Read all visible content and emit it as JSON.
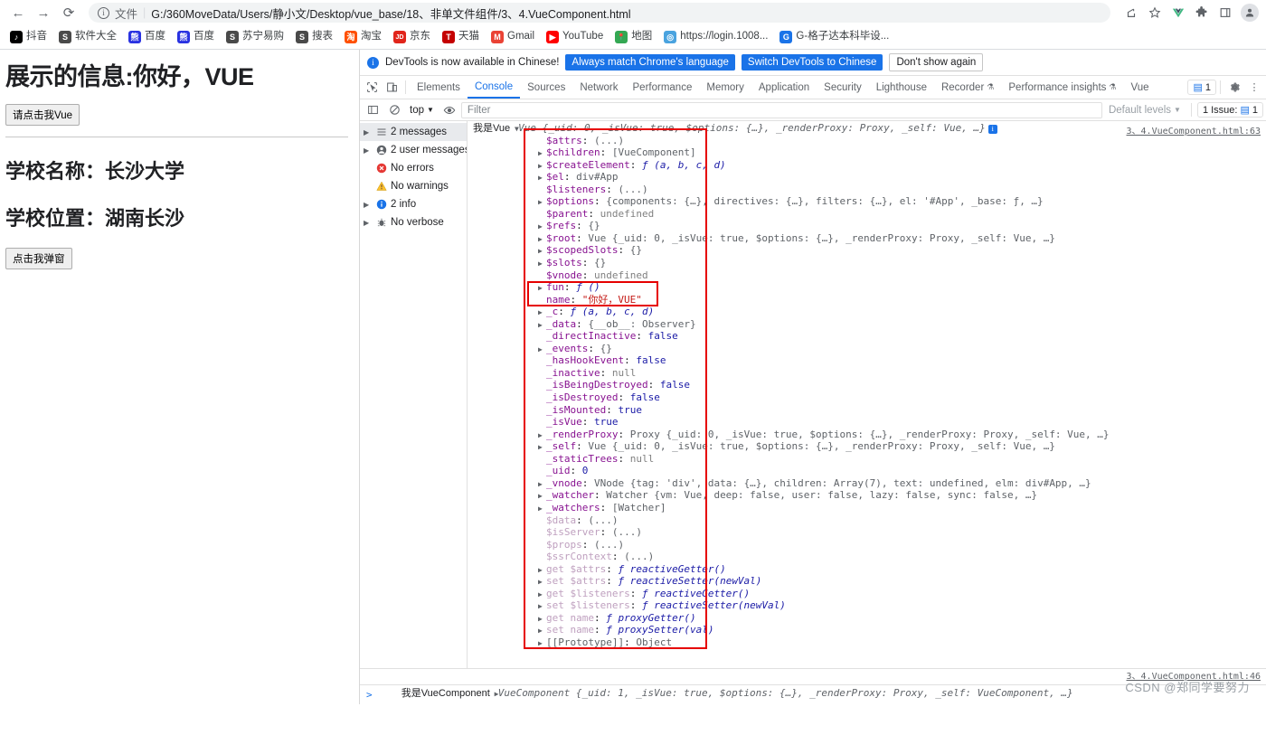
{
  "browser": {
    "nav": {
      "back_icon": "arrow-left-icon",
      "forward_icon": "arrow-right-icon",
      "reload_icon": "reload-icon"
    },
    "omnibox": {
      "info_icon": "info-circle-icon",
      "scheme_label": "文件",
      "url": "G:/360MoveData/Users/静小文/Desktop/vue_base/18、非单文件组件/3、4.VueComponent.html"
    },
    "toolbar_icons": [
      {
        "name": "share-icon",
        "glyph": "⇪"
      },
      {
        "name": "bookmark-star-icon",
        "glyph": "☆"
      },
      {
        "name": "vue-devtools-extension-icon",
        "glyph": "V"
      },
      {
        "name": "extensions-puzzle-icon",
        "glyph": "🧩"
      },
      {
        "name": "sidepanel-icon",
        "glyph": "▯"
      },
      {
        "name": "profile-avatar-icon",
        "glyph": "●"
      }
    ],
    "bookmarks": [
      {
        "label": "抖音",
        "color": "#000000",
        "glyph": "♪"
      },
      {
        "label": "软件大全",
        "color": "#4a4a4a",
        "glyph": "S"
      },
      {
        "label": "百度",
        "color": "#2932e1",
        "glyph": "熊"
      },
      {
        "label": "百度",
        "color": "#2932e1",
        "glyph": "熊"
      },
      {
        "label": "苏宁易购",
        "color": "#4a4a4a",
        "glyph": "S"
      },
      {
        "label": "搜表",
        "color": "#4a4a4a",
        "glyph": "S"
      },
      {
        "label": "淘宝",
        "color": "#ff5000",
        "glyph": "淘"
      },
      {
        "label": "京东",
        "color": "#e1251b",
        "glyph": "JD"
      },
      {
        "label": "天猫",
        "color": "#c40000",
        "glyph": "T"
      },
      {
        "label": "Gmail",
        "color": "#ea4335",
        "glyph": "M"
      },
      {
        "label": "YouTube",
        "color": "#ff0000",
        "glyph": "▶"
      },
      {
        "label": "地图",
        "color": "#34a853",
        "glyph": "📍"
      },
      {
        "label": "https://login.1008...",
        "color": "#4aa3df",
        "glyph": "◎"
      },
      {
        "label": "G-格子达本科毕设...",
        "color": "#1a73e8",
        "glyph": "G"
      }
    ]
  },
  "page": {
    "heading": "展示的信息:你好，VUE",
    "button_vue": "请点击我Vue",
    "school_name_line": "学校名称：长沙大学",
    "school_location_line": "学校位置：湖南长沙",
    "button_alert": "点击我弹窗"
  },
  "devtools": {
    "banner": {
      "icon": "info-circle-icon",
      "text": "DevTools is now available in Chinese!",
      "btn_always": "Always match Chrome's language",
      "btn_switch": "Switch DevTools to Chinese",
      "btn_dismiss": "Don't show again"
    },
    "tabbar": {
      "inspect_icon": "inspect-element-icon",
      "device_icon": "device-toolbar-icon",
      "tabs": [
        {
          "label": "Elements",
          "active": false
        },
        {
          "label": "Console",
          "active": true
        },
        {
          "label": "Sources",
          "active": false
        },
        {
          "label": "Network",
          "active": false
        },
        {
          "label": "Performance",
          "active": false
        },
        {
          "label": "Memory",
          "active": false
        },
        {
          "label": "Application",
          "active": false
        },
        {
          "label": "Security",
          "active": false
        },
        {
          "label": "Lighthouse",
          "active": false
        },
        {
          "label": "Recorder",
          "active": false,
          "badge": "experiment-flask-icon"
        },
        {
          "label": "Performance insights",
          "active": false,
          "badge": "experiment-flask-icon"
        },
        {
          "label": "Vue",
          "active": false
        }
      ],
      "message_count": "1",
      "settings_icon": "gear-icon",
      "more_icon": "kebab-menu-icon"
    },
    "filterbar": {
      "sidebar_toggle_icon": "console-sidebar-icon",
      "clear_icon": "clear-console-icon",
      "context_label": "top",
      "eye_icon": "live-expression-eye-icon",
      "filter_placeholder": "Filter",
      "filter_value": "",
      "levels_label": "Default levels",
      "issues_label": "1 Issue:",
      "issues_count": "1"
    },
    "sidebar": [
      {
        "label": "2 messages",
        "icon": "list-icon",
        "arrow": true,
        "selected": true
      },
      {
        "label": "2 user messages",
        "icon": "user-icon",
        "arrow": true,
        "selected": false
      },
      {
        "label": "No errors",
        "icon": "error-icon",
        "arrow": false,
        "selected": false
      },
      {
        "label": "No warnings",
        "icon": "warning-icon",
        "arrow": false,
        "selected": false
      },
      {
        "label": "2 info",
        "icon": "info-icon",
        "arrow": true,
        "selected": false
      },
      {
        "label": "No verbose",
        "icon": "verbose-bug-icon",
        "arrow": true,
        "selected": false
      }
    ],
    "console": {
      "entry1_source": "3、4.VueComponent.html:63",
      "entry2_source": "3、4.VueComponent.html:46",
      "entry1_prefix": "我是Vue",
      "entry1_summary": "Vue {_uid: 0, _isVue: true, $options: {…}, _renderProxy: Proxy, _self: Vue, …}",
      "entry2_prefix": "我是VueComponent",
      "entry2_summary": "VueComponent {_uid: 1, _isVue: true, $options: {…}, _renderProxy: Proxy, _self: VueComponent, …}",
      "prompt_glyph": ">",
      "properties": [
        {
          "arrow": false,
          "name": "$attrs",
          "sep": ": ",
          "value": "(...)",
          "vclass": "v-obj"
        },
        {
          "arrow": true,
          "name": "$children",
          "sep": ": ",
          "value": "[VueComponent]",
          "vclass": "v-obj"
        },
        {
          "arrow": true,
          "name": "$createElement",
          "sep": ": ",
          "value": "ƒ (a, b, c, d)",
          "vclass": "fn"
        },
        {
          "arrow": true,
          "name": "$el",
          "sep": ": ",
          "value": "div#App",
          "vclass": "v-obj"
        },
        {
          "arrow": false,
          "name": "$listeners",
          "sep": ": ",
          "value": "(...)",
          "vclass": "v-obj"
        },
        {
          "arrow": true,
          "name": "$options",
          "sep": ": ",
          "value": "{components: {…}, directives: {…}, filters: {…}, el: '#App', _base: ƒ, …}",
          "vclass": "v-obj"
        },
        {
          "arrow": false,
          "name": "$parent",
          "sep": ": ",
          "value": "undefined",
          "vclass": "v-und"
        },
        {
          "arrow": true,
          "name": "$refs",
          "sep": ": ",
          "value": "{}",
          "vclass": "v-obj"
        },
        {
          "arrow": true,
          "name": "$root",
          "sep": ": ",
          "value": "Vue {_uid: 0, _isVue: true, $options: {…}, _renderProxy: Proxy, _self: Vue, …}",
          "vclass": "v-obj"
        },
        {
          "arrow": true,
          "name": "$scopedSlots",
          "sep": ": ",
          "value": "{}",
          "vclass": "v-obj"
        },
        {
          "arrow": true,
          "name": "$slots",
          "sep": ": ",
          "value": "{}",
          "vclass": "v-obj"
        },
        {
          "arrow": false,
          "name": "$vnode",
          "sep": ": ",
          "value": "undefined",
          "vclass": "v-und"
        },
        {
          "arrow": true,
          "name": "fun",
          "sep": ": ",
          "value": "ƒ ()",
          "vclass": "fn"
        },
        {
          "arrow": false,
          "name": "name",
          "sep": ": ",
          "value": "\"你好，VUE\"",
          "vclass": "v-str"
        },
        {
          "arrow": true,
          "name": "_c",
          "sep": ": ",
          "value": "ƒ (a, b, c, d)",
          "vclass": "fn"
        },
        {
          "arrow": true,
          "name": "_data",
          "sep": ": ",
          "value": "{__ob__: Observer}",
          "vclass": "v-obj"
        },
        {
          "arrow": false,
          "name": "_directInactive",
          "sep": ": ",
          "value": "false",
          "vclass": "v-bool"
        },
        {
          "arrow": true,
          "name": "_events",
          "sep": ": ",
          "value": "{}",
          "vclass": "v-obj"
        },
        {
          "arrow": false,
          "name": "_hasHookEvent",
          "sep": ": ",
          "value": "false",
          "vclass": "v-bool"
        },
        {
          "arrow": false,
          "name": "_inactive",
          "sep": ": ",
          "value": "null",
          "vclass": "v-null"
        },
        {
          "arrow": false,
          "name": "_isBeingDestroyed",
          "sep": ": ",
          "value": "false",
          "vclass": "v-bool"
        },
        {
          "arrow": false,
          "name": "_isDestroyed",
          "sep": ": ",
          "value": "false",
          "vclass": "v-bool"
        },
        {
          "arrow": false,
          "name": "_isMounted",
          "sep": ": ",
          "value": "true",
          "vclass": "v-bool"
        },
        {
          "arrow": false,
          "name": "_isVue",
          "sep": ": ",
          "value": "true",
          "vclass": "v-bool"
        },
        {
          "arrow": true,
          "name": "_renderProxy",
          "sep": ": ",
          "value": "Proxy {_uid: 0, _isVue: true, $options: {…}, _renderProxy: Proxy, _self: Vue, …}",
          "vclass": "v-obj"
        },
        {
          "arrow": true,
          "name": "_self",
          "sep": ": ",
          "value": "Vue {_uid: 0, _isVue: true, $options: {…}, _renderProxy: Proxy, _self: Vue, …}",
          "vclass": "v-obj"
        },
        {
          "arrow": false,
          "name": "_staticTrees",
          "sep": ": ",
          "value": "null",
          "vclass": "v-null"
        },
        {
          "arrow": false,
          "name": "_uid",
          "sep": ": ",
          "value": "0",
          "vclass": "v-num"
        },
        {
          "arrow": true,
          "name": "_vnode",
          "sep": ": ",
          "value": "VNode {tag: 'div', data: {…}, children: Array(7), text: undefined, elm: div#App, …}",
          "vclass": "v-obj"
        },
        {
          "arrow": true,
          "name": "_watcher",
          "sep": ": ",
          "value": "Watcher {vm: Vue, deep: false, user: false, lazy: false, sync: false, …}",
          "vclass": "v-obj"
        },
        {
          "arrow": true,
          "name": "_watchers",
          "sep": ": ",
          "value": "[Watcher]",
          "vclass": "v-obj"
        },
        {
          "arrow": false,
          "name": "$data",
          "sep": ": ",
          "value": "(...)",
          "vclass": "v-obj",
          "faded": true
        },
        {
          "arrow": false,
          "name": "$isServer",
          "sep": ": ",
          "value": "(...)",
          "vclass": "v-obj",
          "faded": true
        },
        {
          "arrow": false,
          "name": "$props",
          "sep": ": ",
          "value": "(...)",
          "vclass": "v-obj",
          "faded": true
        },
        {
          "arrow": false,
          "name": "$ssrContext",
          "sep": ": ",
          "value": "(...)",
          "vclass": "v-obj",
          "faded": true
        },
        {
          "arrow": true,
          "name": "get $attrs",
          "sep": ": ",
          "value": "ƒ reactiveGetter()",
          "vclass": "fn",
          "faded": true
        },
        {
          "arrow": true,
          "name": "set $attrs",
          "sep": ": ",
          "value": "ƒ reactiveSetter(newVal)",
          "vclass": "fn",
          "faded": true
        },
        {
          "arrow": true,
          "name": "get $listeners",
          "sep": ": ",
          "value": "ƒ reactiveGetter()",
          "vclass": "fn",
          "faded": true
        },
        {
          "arrow": true,
          "name": "set $listeners",
          "sep": ": ",
          "value": "ƒ reactiveSetter(newVal)",
          "vclass": "fn",
          "faded": true
        },
        {
          "arrow": true,
          "name": "get name",
          "sep": ": ",
          "value": "ƒ proxyGetter()",
          "vclass": "fn",
          "faded": true
        },
        {
          "arrow": true,
          "name": "set name",
          "sep": ": ",
          "value": "ƒ proxySetter(val)",
          "vclass": "fn",
          "faded": true
        },
        {
          "arrow": true,
          "name": "[[Prototype]]",
          "sep": ": ",
          "value": "Object",
          "vclass": "v-obj",
          "pclass": "dim"
        }
      ]
    }
  },
  "watermark": "CSDN @郑同学要努力",
  "colors": {
    "accent_blue": "#1a73e8",
    "highlight_red": "#e60000",
    "property_purple": "#881391",
    "string_red": "#c41a16"
  }
}
